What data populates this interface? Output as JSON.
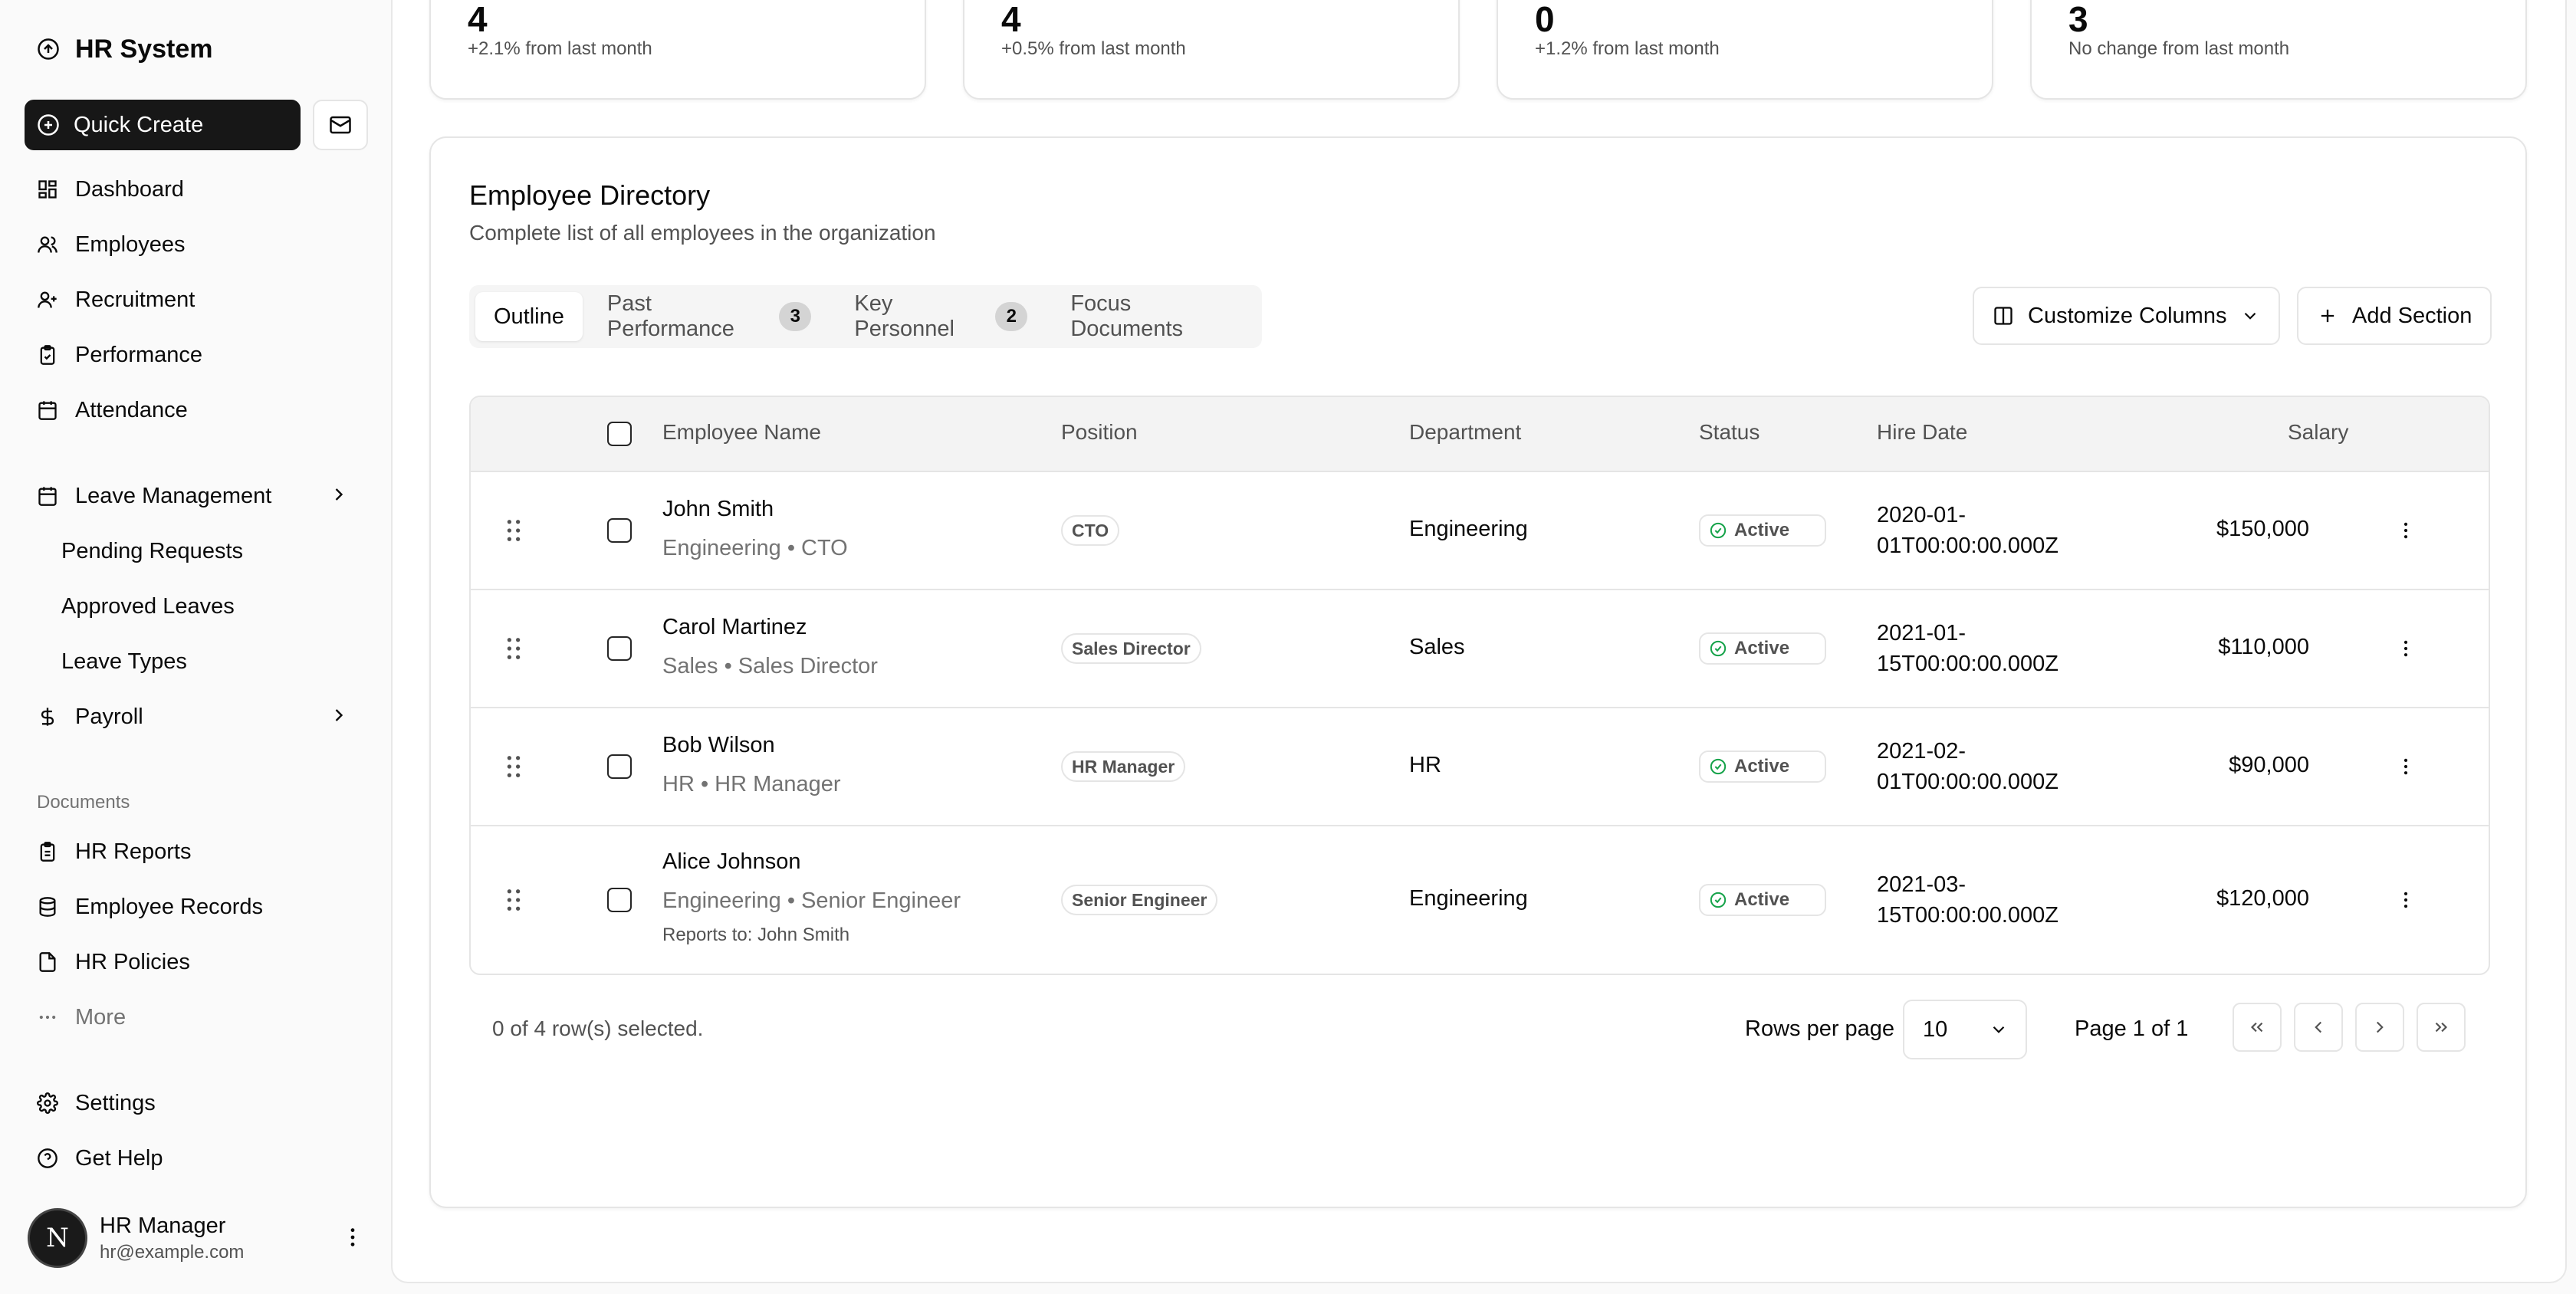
{
  "app": {
    "title": "HR System"
  },
  "sidebar": {
    "quick_create": "Quick Create",
    "nav": [
      {
        "label": "Dashboard",
        "icon": "dashboard-icon"
      },
      {
        "label": "Employees",
        "icon": "users-icon"
      },
      {
        "label": "Recruitment",
        "icon": "user-plus-icon"
      },
      {
        "label": "Performance",
        "icon": "clipboard-check-icon"
      },
      {
        "label": "Attendance",
        "icon": "calendar-icon"
      }
    ],
    "leave_management": {
      "label": "Leave Management",
      "children": [
        "Pending Requests",
        "Approved Leaves",
        "Leave Types"
      ]
    },
    "payroll": {
      "label": "Payroll"
    },
    "documents_label": "Documents",
    "documents": [
      {
        "label": "HR Reports",
        "icon": "clipboard-icon"
      },
      {
        "label": "Employee Records",
        "icon": "database-icon"
      },
      {
        "label": "HR Policies",
        "icon": "file-icon"
      }
    ],
    "more": "More",
    "settings": "Settings",
    "help": "Get Help",
    "user": {
      "initial": "N",
      "name": "HR Manager",
      "email": "hr@example.com"
    }
  },
  "stats": [
    {
      "value": "4",
      "note": "+2.1% from last month"
    },
    {
      "value": "4",
      "note": "+0.5% from last month"
    },
    {
      "value": "0",
      "note": "+1.2% from last month"
    },
    {
      "value": "3",
      "note": "No change from last month"
    }
  ],
  "directory": {
    "title": "Employee Directory",
    "subtitle": "Complete list of all employees in the organization",
    "tabs": [
      {
        "label": "Outline",
        "badge": ""
      },
      {
        "label": "Past Performance",
        "badge": "3"
      },
      {
        "label": "Key Personnel",
        "badge": "2"
      },
      {
        "label": "Focus Documents",
        "badge": ""
      }
    ],
    "customize_columns": "Customize Columns",
    "add_section": "Add Section",
    "columns": {
      "name": "Employee Name",
      "position": "Position",
      "department": "Department",
      "status": "Status",
      "hire_date": "Hire Date",
      "salary": "Salary"
    },
    "rows": [
      {
        "name": "John Smith",
        "sub": "Engineering • CTO",
        "reports": "",
        "position": "CTO",
        "department": "Engineering",
        "status": "Active",
        "hire_date": "2020-01-01T00:00:00.000Z",
        "salary": "$150,000"
      },
      {
        "name": "Carol Martinez",
        "sub": "Sales • Sales Director",
        "reports": "",
        "position": "Sales Director",
        "department": "Sales",
        "status": "Active",
        "hire_date": "2021-01-15T00:00:00.000Z",
        "salary": "$110,000"
      },
      {
        "name": "Bob Wilson",
        "sub": "HR • HR Manager",
        "reports": "",
        "position": "HR Manager",
        "department": "HR",
        "status": "Active",
        "hire_date": "2021-02-01T00:00:00.000Z",
        "salary": "$90,000"
      },
      {
        "name": "Alice Johnson",
        "sub": "Engineering • Senior Engineer",
        "reports": "Reports to: John Smith",
        "position": "Senior Engineer",
        "department": "Engineering",
        "status": "Active",
        "hire_date": "2021-03-15T00:00:00.000Z",
        "salary": "$120,000"
      }
    ],
    "footer": {
      "selected": "0 of 4 row(s) selected.",
      "rows_per_page_label": "Rows per page",
      "rows_per_page": "10",
      "page_info": "Page 1 of 1"
    }
  },
  "colors": {
    "primary": "#171717",
    "status_ok": "#16a34a",
    "border": "#e5e5e5"
  }
}
